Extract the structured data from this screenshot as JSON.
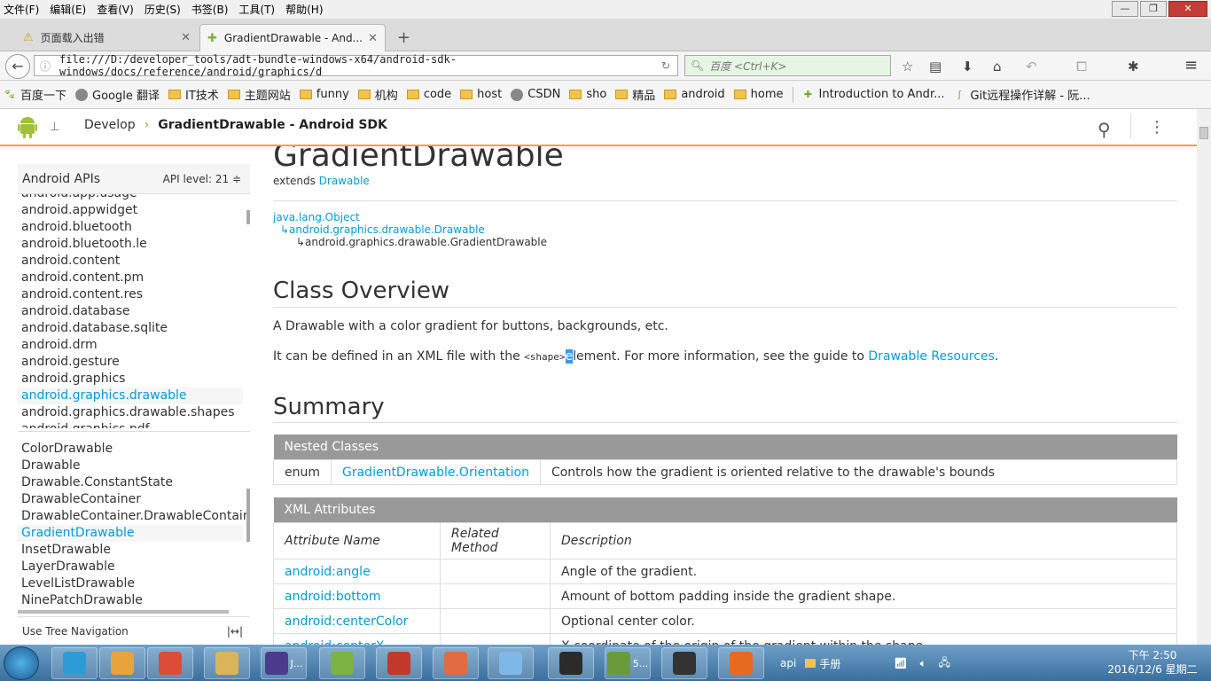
{
  "browser": {
    "menu": [
      "文件(F)",
      "编辑(E)",
      "查看(V)",
      "历史(S)",
      "书签(B)",
      "工具(T)",
      "帮助(H)"
    ],
    "win_controls": [
      "—",
      "❐",
      "✕"
    ],
    "tabs": [
      {
        "label": "页面载入出错",
        "icon": "warning-icon"
      },
      {
        "label": "GradientDrawable - And...",
        "icon": "android-icon"
      }
    ],
    "new_tab": "+",
    "url": "file:///D:/developer_tools/adt-bundle-windows-x64/android-sdk-windows/docs/reference/android/graphics/d",
    "search_placeholder": "百度 <Ctrl+K>",
    "bookmarks": [
      {
        "label": "百度一下",
        "icon": "baidu-icon"
      },
      {
        "label": "Google 翻译",
        "icon": "globe-icon"
      },
      {
        "label": "IT技术",
        "icon": "folder-icon"
      },
      {
        "label": "主题网站",
        "icon": "folder-icon"
      },
      {
        "label": "funny",
        "icon": "folder-icon"
      },
      {
        "label": "机构",
        "icon": "folder-icon"
      },
      {
        "label": "code",
        "icon": "folder-icon"
      },
      {
        "label": "host",
        "icon": "folder-icon"
      },
      {
        "label": "CSDN",
        "icon": "globe-icon"
      },
      {
        "label": "sho",
        "icon": "folder-icon"
      },
      {
        "label": "精品",
        "icon": "folder-icon"
      },
      {
        "label": "android",
        "icon": "folder-icon"
      },
      {
        "label": "home",
        "icon": "folder-icon"
      },
      {
        "label": "Introduction to Andr...",
        "icon": "android-icon"
      },
      {
        "label": "Git远程操作详解 - 阮...",
        "icon": "bird-icon"
      }
    ]
  },
  "site": {
    "breadcrumb_root": "Develop",
    "breadcrumb_current": "GradientDrawable - Android SDK"
  },
  "sidebar": {
    "title": "Android APIs",
    "api_label": "API level:",
    "api_value": "21 ≑",
    "packages_top_partial": "android.app.usage",
    "packages": [
      "android.appwidget",
      "android.bluetooth",
      "android.bluetooth.le",
      "android.content",
      "android.content.pm",
      "android.content.res",
      "android.database",
      "android.database.sqlite",
      "android.drm",
      "android.gesture",
      "android.graphics",
      "android.graphics.drawable",
      "android.graphics.drawable.shapes",
      "android.graphics.pdf"
    ],
    "selected_package": "android.graphics.drawable",
    "classes": [
      "ColorDrawable",
      "Drawable",
      "Drawable.ConstantState",
      "DrawableContainer",
      "DrawableContainer.DrawableContainerS",
      "GradientDrawable",
      "InsetDrawable",
      "LayerDrawable",
      "LevelListDrawable",
      "NinePatchDrawable"
    ],
    "selected_class": "GradientDrawable",
    "footer": "Use Tree Navigation",
    "footer_toggle": "|↔|"
  },
  "doc": {
    "title": "GradientDrawable",
    "extends_label": "extends ",
    "extends_link": "Drawable",
    "inheritance": [
      "java.lang.Object",
      "↳android.graphics.drawable.Drawable",
      "↳android.graphics.drawable.GradientDrawable"
    ],
    "overview_heading": "Class Overview",
    "overview_p1": "A Drawable with a color gradient for buttons, backgrounds, etc.",
    "overview_p2_a": "It can be defined in an XML file with the ",
    "overview_p2_code": "<shape>",
    "overview_p2_hl": "e",
    "overview_p2_b": "lement. For more information, see the guide to ",
    "overview_p2_link": "Drawable Resources",
    "overview_p2_end": ".",
    "summary_heading": "Summary",
    "nested_heading": "Nested Classes",
    "nested": [
      {
        "kind": "enum",
        "name": "GradientDrawable.Orientation",
        "desc": "Controls how the gradient is oriented relative to the drawable's bounds"
      }
    ],
    "xml_heading": "XML Attributes",
    "xml_cols": [
      "Attribute Name",
      "Related Method",
      "Description"
    ],
    "xml_rows": [
      {
        "name": "android:angle",
        "method": "",
        "desc": "Angle of the gradient."
      },
      {
        "name": "android:bottom",
        "method": "",
        "desc": "Amount of bottom padding inside the gradient shape."
      },
      {
        "name": "android:centerColor",
        "method": "",
        "desc": "Optional center color."
      },
      {
        "name": "android:centerX",
        "method": "",
        "desc": "X coordinate of the origin of the gradient within the shape."
      }
    ]
  },
  "taskbar": {
    "apps": [
      {
        "name": "start-button",
        "label": ""
      },
      {
        "name": "taskbar-app-1",
        "label": ""
      },
      {
        "name": "taskbar-app-2",
        "label": ""
      },
      {
        "name": "taskbar-chrome",
        "label": ""
      },
      {
        "name": "taskbar-explorer",
        "label": ""
      },
      {
        "name": "taskbar-eclipse",
        "label": "J..."
      },
      {
        "name": "taskbar-android-studio",
        "label": ""
      },
      {
        "name": "taskbar-m",
        "label": ""
      },
      {
        "name": "taskbar-p",
        "label": ""
      },
      {
        "name": "taskbar-weather",
        "label": ""
      },
      {
        "name": "taskbar-nox",
        "label": ""
      },
      {
        "name": "taskbar-phone",
        "label": "5..."
      },
      {
        "name": "taskbar-recorder",
        "label": ""
      },
      {
        "name": "taskbar-firefox",
        "label": ""
      }
    ],
    "tray_text_1": "api",
    "tray_text_2": "手册",
    "time": "下午 2:50",
    "date": "2016/12/6 星期二"
  }
}
